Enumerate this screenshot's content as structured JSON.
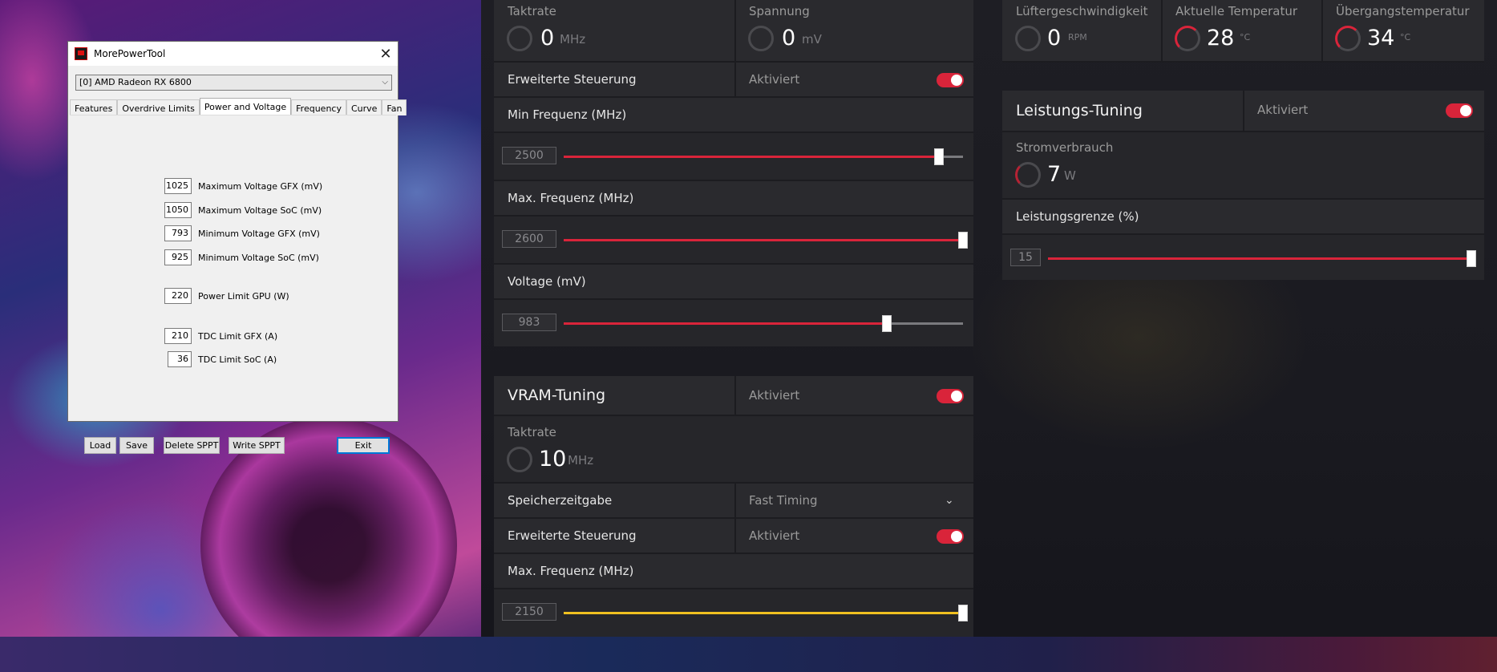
{
  "mpt": {
    "title": "MorePowerTool",
    "device": "[0] AMD Radeon RX 6800",
    "tabs": [
      "Features",
      "Overdrive Limits",
      "Power and Voltage",
      "Frequency",
      "Curve",
      "Fan"
    ],
    "active_tab": "Power and Voltage",
    "fields": [
      {
        "value": "1025",
        "label": "Maximum Voltage GFX (mV)"
      },
      {
        "value": "1050",
        "label": "Maximum Voltage SoC (mV)"
      },
      {
        "value": "793",
        "label": "Minimum Voltage GFX (mV)"
      },
      {
        "value": "925",
        "label": "Minimum Voltage SoC (mV)"
      },
      {
        "value": "220",
        "label": "Power Limit GPU (W)"
      },
      {
        "value": "210",
        "label": "TDC Limit GFX (A)"
      },
      {
        "value": "36",
        "label": "TDC Limit SoC (A)"
      }
    ],
    "buttons": {
      "load": "Load",
      "save": "Save",
      "delete_sppt": "Delete SPPT",
      "write_sppt": "Write SPPT",
      "exit": "Exit"
    }
  },
  "gpu_tuning": {
    "clock_label": "Taktrate",
    "clock_value": "0",
    "clock_unit": "MHz",
    "voltage_label": "Spannung",
    "voltage_value": "0",
    "voltage_unit": "mV",
    "advanced_label": "Erweiterte Steuerung",
    "advanced_state": "Aktiviert",
    "min_freq_label": "Min Frequenz (MHz)",
    "min_freq_value": "2500",
    "min_freq_fraction": 0.94,
    "max_freq_label": "Max. Frequenz (MHz)",
    "max_freq_value": "2600",
    "max_freq_fraction": 1.0,
    "volt_label": "Voltage (mV)",
    "volt_value": "983",
    "volt_fraction": 0.81
  },
  "vram_tuning": {
    "title": "VRAM-Tuning",
    "state": "Aktiviert",
    "clock_label": "Taktrate",
    "clock_value": "10",
    "clock_unit": "MHz",
    "timing_label": "Speicherzeitgabe",
    "timing_value": "Fast Timing",
    "advanced_label": "Erweiterte Steuerung",
    "advanced_state": "Aktiviert",
    "max_freq_label": "Max. Frequenz (MHz)",
    "max_freq_value": "2150",
    "max_freq_fraction": 1.0
  },
  "sensors": {
    "fan_label": "Lüftergeschwindigkeit",
    "fan_value": "0",
    "fan_unit": "RPM",
    "temp_label": "Aktuelle Temperatur",
    "temp_value": "28",
    "temp_unit": "°C",
    "junction_label": "Übergangstemperatur",
    "junction_value": "34",
    "junction_unit": "°C"
  },
  "power_tuning": {
    "title": "Leistungs-Tuning",
    "state": "Aktiviert",
    "consumption_label": "Stromverbrauch",
    "consumption_value": "7",
    "consumption_unit": "W",
    "limit_label": "Leistungsgrenze (%)",
    "limit_value": "15",
    "limit_fraction": 1.0
  },
  "colors": {
    "accent": "#d9243a",
    "vram_accent": "#f0c020",
    "panel": "#26262a"
  }
}
